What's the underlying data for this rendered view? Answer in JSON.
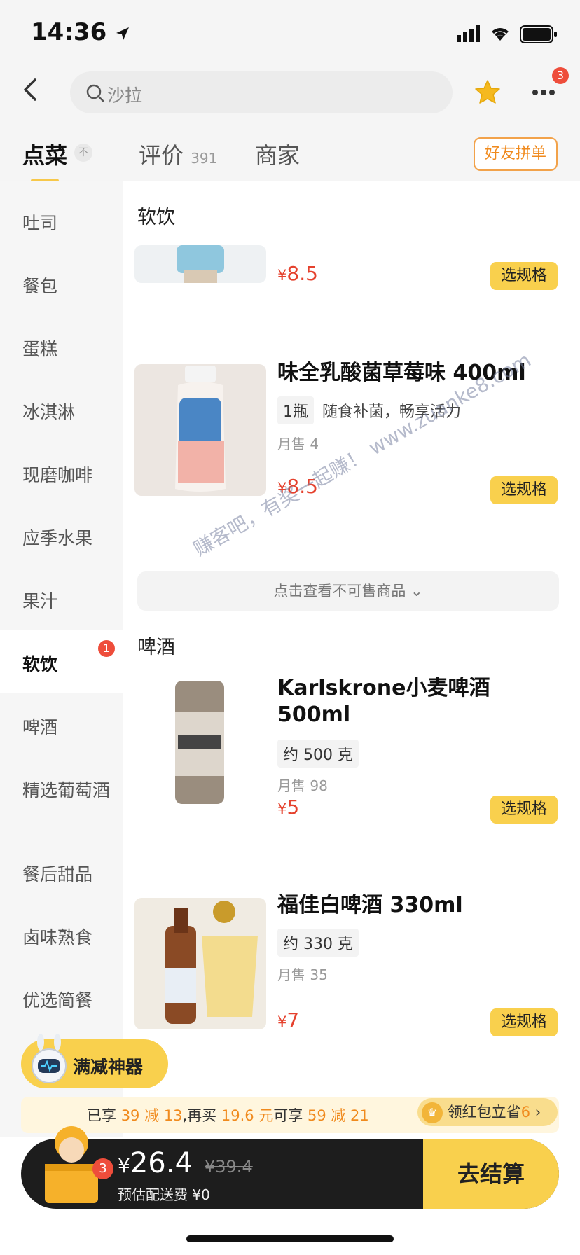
{
  "status": {
    "time": "14:36"
  },
  "search": {
    "placeholder": "沙拉"
  },
  "header": {
    "more_badge": "3"
  },
  "tabs": [
    {
      "label": "点菜",
      "sort_icon": "不"
    },
    {
      "label": "评价",
      "count": "391"
    },
    {
      "label": "商家"
    }
  ],
  "friends_button": "好友拼单",
  "sidebar": {
    "items": [
      "吐司",
      "餐包",
      "蛋糕",
      "冰淇淋",
      "现磨咖啡",
      "应季水果",
      "果汁",
      "软饮",
      "啤酒",
      "精选葡萄酒",
      "餐后甜品",
      "卤味熟食",
      "优选简餐"
    ],
    "active": "软饮",
    "active_badge": "1"
  },
  "sections": {
    "soft_drinks": {
      "title": "软饮",
      "items": [
        {
          "price_symbol": "¥",
          "price": "8.5",
          "button": "选规格"
        },
        {
          "name": "味全乳酸菌草莓味 400ml",
          "tag": "1瓶",
          "desc": "随食补菌，畅享活力",
          "sold": "月售 4",
          "price_symbol": "¥",
          "price": "8.5",
          "button": "选规格"
        }
      ]
    },
    "not_for_sale": "点击查看不可售商品",
    "beer": {
      "title": "啤酒",
      "items": [
        {
          "name_line1": "Karlskrone小麦啤酒",
          "name_line2": "500ml",
          "tag": "约 500 克",
          "sold": "月售 98",
          "price_symbol": "¥",
          "price": "5",
          "button": "选规格"
        },
        {
          "name": "福佳白啤酒 330ml",
          "tag": "约 330 克",
          "sold": "月售 35",
          "price_symbol": "¥",
          "price": "7",
          "button": "选规格"
        }
      ]
    }
  },
  "watermark": "赚客吧，有奖一起赚！ www.zuanke8.com",
  "promo": {
    "label": "满减神器"
  },
  "savings": {
    "prefix": "已享 ",
    "hl1": "39 减 13",
    "mid1": ",再买 ",
    "hl2": "19.6 元",
    "mid2": "可享 ",
    "hl3": "59 减 21",
    "redpacket_label": "领红包立省",
    "redpacket_value": "6"
  },
  "cart": {
    "badge": "3",
    "yen": "¥",
    "total": "26.4",
    "original": "¥39.4",
    "delivery": "预估配送费 ¥0",
    "checkout": "去结算"
  }
}
